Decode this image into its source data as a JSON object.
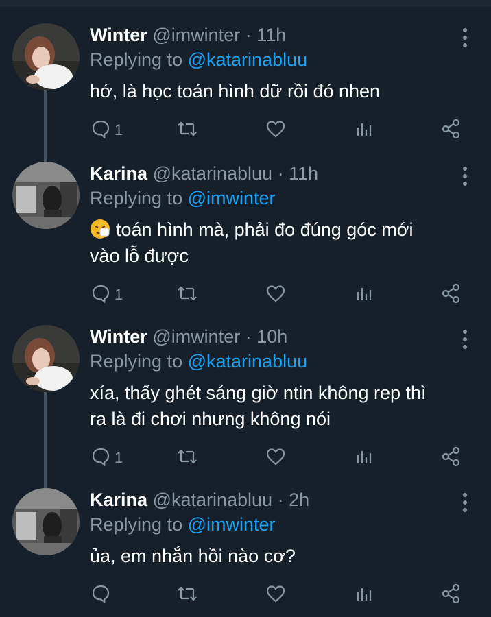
{
  "tweets": [
    {
      "name": "Winter",
      "handle": "@imwinter",
      "sep": "·",
      "time": "11h",
      "replying_prefix": "Replying to",
      "replying_to": "@katarinabluu",
      "text_line1": "hớ, là học toán hình dữ rồi đó nhen",
      "text_line2": "",
      "replies": "1",
      "avatar": "winter-avatar",
      "has_emoji": false
    },
    {
      "name": "Karina",
      "handle": "@katarinabluu",
      "sep": "·",
      "time": "11h",
      "replying_prefix": "Replying to",
      "replying_to": "@imwinter",
      "text_line1": "toán hình mà, phải đo đúng góc mới",
      "text_line2": "vào lỗ được",
      "replies": "1",
      "avatar": "karina-avatar",
      "has_emoji": true
    },
    {
      "name": "Winter",
      "handle": "@imwinter",
      "sep": "·",
      "time": "10h",
      "replying_prefix": "Replying to",
      "replying_to": "@katarinabluu",
      "text_line1": "xía, thấy ghét sáng giờ ntin không rep thì",
      "text_line2": "ra là đi chơi nhưng không nói",
      "replies": "1",
      "avatar": "winter-avatar",
      "has_emoji": false
    },
    {
      "name": "Karina",
      "handle": "@katarinabluu",
      "sep": "·",
      "time": "2h",
      "replying_prefix": "Replying to",
      "replying_to": "@imwinter",
      "text_line1": "ủa, em nhắn hồi nào cơ?",
      "text_line2": "",
      "replies": "",
      "avatar": "karina-avatar",
      "has_emoji": false
    }
  ],
  "icons": {
    "reply": "reply-icon",
    "retweet": "retweet-icon",
    "like": "like-icon",
    "analytics": "analytics-icon",
    "share": "share-icon",
    "menu": "more-icon"
  },
  "colors": {
    "background": "#15202b",
    "secondary_text": "#8899a6",
    "link": "#1da1f2",
    "thread_line": "#425364"
  }
}
